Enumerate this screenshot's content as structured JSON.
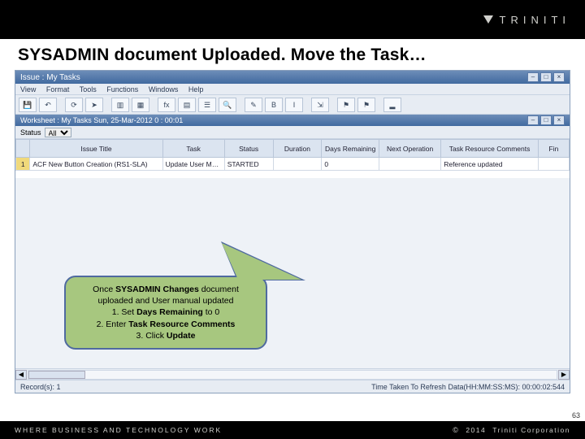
{
  "brand": {
    "name": "TRINITI"
  },
  "slide": {
    "title": "SYSADMIN document Uploaded. Move the Task…"
  },
  "app": {
    "title": "Issue : My Tasks",
    "menus": [
      "View",
      "Format",
      "Tools",
      "Functions",
      "Windows",
      "Help"
    ],
    "sheet_title": "Worksheet : My Tasks Sun, 25-Mar-2012 0 : 00:01",
    "status_label": "Status",
    "status_value": "All"
  },
  "columns": [
    "Issue Title",
    "Task",
    "Status",
    "Duration",
    "Days Remaining",
    "Next Operation",
    "Task Resource Comments",
    "Fin"
  ],
  "row": {
    "num": "1",
    "cells": [
      "ACF New Button Creation (RS1-SLA)",
      "Update User Manual",
      "STARTED",
      "",
      "0",
      "",
      "Reference updated",
      ""
    ]
  },
  "callout": {
    "l1a": "Once ",
    "l1b": "SYSADMIN Changes",
    "l1c": " document",
    "l2": "uploaded and User manual updated",
    "l3a": "1. Set ",
    "l3b": "Days Remaining",
    "l3c": " to 0",
    "l4a": "2. Enter ",
    "l4b": "Task Resource Comments",
    "l5a": "3. Click ",
    "l5b": "Update"
  },
  "statusbar": {
    "left": "Record(s): 1",
    "right": "Time Taken To Refresh Data(HH:MM:SS:MS): 00:00:02:544"
  },
  "footer": {
    "tagline": "WHERE BUSINESS AND TECHNOLOGY WORK",
    "year": "2014",
    "corp": "Triniti Corporation",
    "copy": "©"
  },
  "page": "63"
}
